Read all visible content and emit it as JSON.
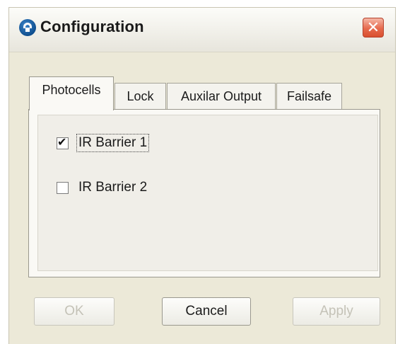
{
  "window": {
    "title": "Configuration",
    "title_icon": "app-logo-icon",
    "close_icon": "close-icon",
    "close_glyph": "✕",
    "colors": {
      "close_button": "#e0593a",
      "dialog_background": "#ece9d8"
    }
  },
  "tabs": [
    {
      "label": "Photocells",
      "active": true
    },
    {
      "label": "Lock",
      "active": false
    },
    {
      "label": "Auxilar Output",
      "active": false
    },
    {
      "label": "Failsafe",
      "active": false
    }
  ],
  "photocells": {
    "options": [
      {
        "label": "IR Barrier 1",
        "checked": true,
        "focused": true
      },
      {
        "label": "IR Barrier 2",
        "checked": false,
        "focused": false
      }
    ]
  },
  "buttons": {
    "ok": {
      "label": "OK",
      "enabled": false
    },
    "cancel": {
      "label": "Cancel",
      "enabled": true
    },
    "apply": {
      "label": "Apply",
      "enabled": false
    }
  }
}
